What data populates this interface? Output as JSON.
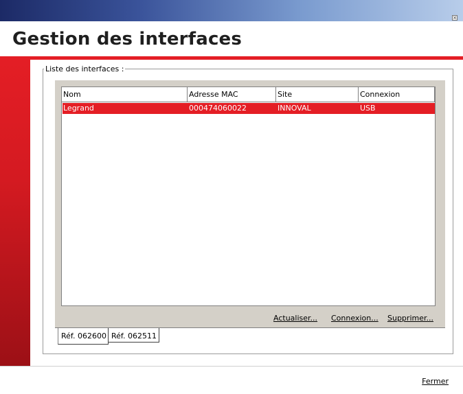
{
  "window": {
    "close_glyph": "×"
  },
  "page": {
    "title": "Gestion des interfaces"
  },
  "group": {
    "label": "Liste des interfaces :"
  },
  "table": {
    "columns": [
      "Nom",
      "Adresse MAC",
      "Site",
      "Connexion"
    ],
    "rows": [
      {
        "nom": "Legrand",
        "mac": "000474060022",
        "site": "INNOVAL",
        "connexion": "USB",
        "selected": true
      }
    ]
  },
  "actions": {
    "refresh": "Actualiser...",
    "connect": "Connexion...",
    "delete": "Supprimer..."
  },
  "tabs": [
    {
      "label": "Réf. 062600",
      "active": true
    },
    {
      "label": "Réf. 062511",
      "active": false
    }
  ],
  "footer": {
    "close_label": "Fermer"
  },
  "colors": {
    "accent_red": "#e41e25",
    "titlebar_dark": "#1c2a66",
    "titlebar_light": "#b8cdea",
    "panel_gray": "#d4d0c8"
  },
  "icons": {
    "close": "close-icon"
  }
}
